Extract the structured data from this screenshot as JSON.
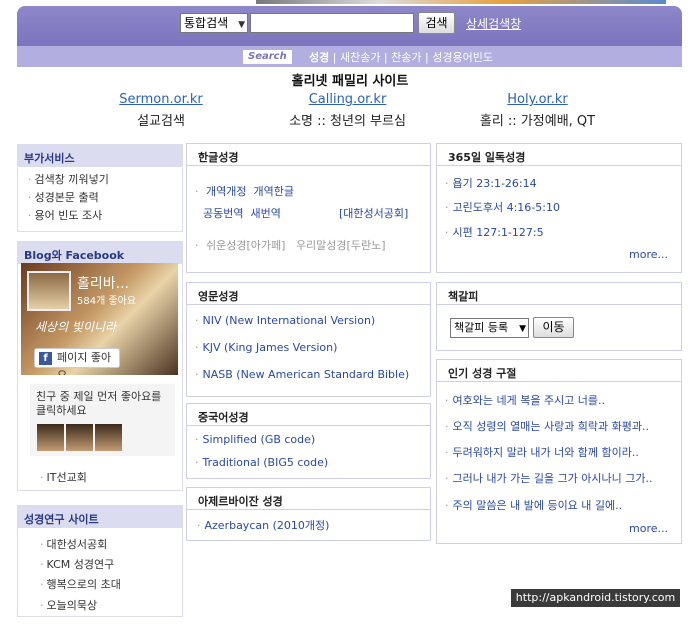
{
  "search": {
    "scope": "통합검색",
    "query": "",
    "button": "검색",
    "advanced": "상세검색창"
  },
  "subnav": {
    "tag": "Search",
    "items": [
      "성경",
      "새찬송가",
      "찬송가",
      "성경용어빈도"
    ],
    "separator": " | "
  },
  "family": {
    "title": "홀리넷 패밀리 사이트",
    "sites": [
      {
        "link": "Sermon.or.kr",
        "desc": "설교검색"
      },
      {
        "link": "Calling.or.kr",
        "desc": "소명 :: 청년의 부르심"
      },
      {
        "link": "Holy.or.kr",
        "desc": "홀리 :: 가정예배, QT"
      }
    ]
  },
  "sidebar": {
    "services": {
      "title": "부가서비스",
      "items": [
        "검색창 끼워넣기",
        "성경본문 출력",
        "용어 빈도 조사"
      ]
    },
    "blog": {
      "title": "Blog와 Facebook",
      "page_name": "홀리바...",
      "likes": "584개 좋아요",
      "slogan": "세상의 빛이니라",
      "like_button": "페이지 좋아요",
      "friends_text": "친구 중 제일 먼저 좋아요를 클릭하세요"
    },
    "it_church": "IT선교회",
    "research": {
      "title": "성경연구 사이트",
      "items": [
        "대한성서공회",
        "KCM 성경연구",
        "행복으로의 초대",
        "오늘의묵상"
      ]
    }
  },
  "korean_bible": {
    "title": "한글성경",
    "line1": [
      "개역개정",
      "개역한글"
    ],
    "line2": [
      "공동번역",
      "새번역"
    ],
    "society": "[대한성서공회]",
    "line3": [
      "쉬운성경[아가페]",
      "우리말성경[두란노]"
    ]
  },
  "english_bible": {
    "title": "영문성경",
    "items": [
      "NIV (New International Version)",
      "KJV (King James Version)",
      "NASB (New American Standard Bible)"
    ]
  },
  "chinese_bible": {
    "title": "중국어성경",
    "items": [
      "Simplified (GB code)",
      "Traditional (BIG5 code)"
    ]
  },
  "azerbaijani_bible": {
    "title": "아제르바이잔 성경",
    "items": [
      "Azerbaycan (2010개정)"
    ]
  },
  "daily_reading": {
    "title": "365일 일독성경",
    "items": [
      "욥기 23:1-26:14",
      "고린도후서 4:16-5:10",
      "시편 127:1-127:5"
    ],
    "more": "more..."
  },
  "bookmark": {
    "title": "책갈피",
    "select_value": "책갈피 등록",
    "button": "이동"
  },
  "popular_verses": {
    "title": "인기 성경 구절",
    "items": [
      "여호와는 네게 복을 주시고 너를..",
      "오직 성령의 열매는 사랑과 희락과 화평과..",
      "두려워하지 말라 내가 너와 함께 함이라..",
      "그러나 내가 가는 길을 그가 아시나니 그가..",
      "주의 말씀은 내 발에 등이요 내 길에.."
    ],
    "more": "more..."
  },
  "watermark": "http://apkandroid.tistory.com"
}
